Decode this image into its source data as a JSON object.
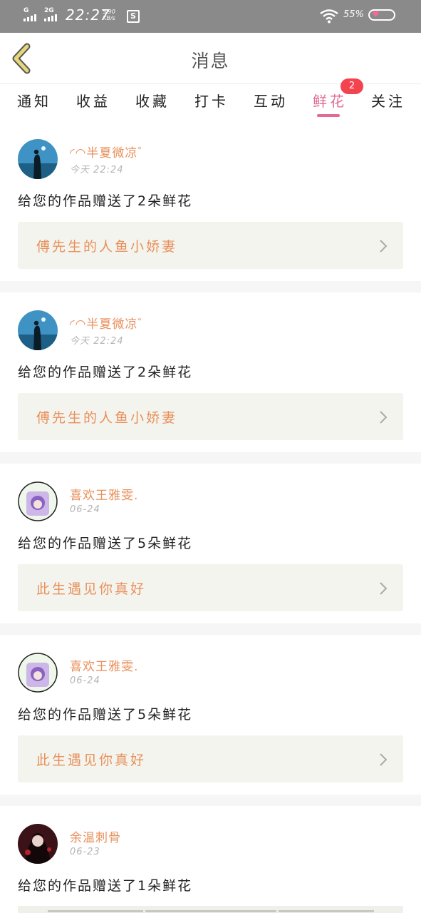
{
  "status_bar": {
    "sim1": "G",
    "sim2": "2G",
    "time": "22:27",
    "speed": "5.90",
    "speed_unit": "KB/s",
    "s_icon": "S",
    "battery": "55%"
  },
  "header": {
    "title": "消息"
  },
  "tabs": [
    {
      "label": "通知"
    },
    {
      "label": "收益"
    },
    {
      "label": "收藏"
    },
    {
      "label": "打卡"
    },
    {
      "label": "互动"
    },
    {
      "label": "鲜花",
      "active": true,
      "badge": "2"
    },
    {
      "label": "关注"
    }
  ],
  "messages": [
    {
      "user": "◜◠半夏微凉゛",
      "time": "今天 22:24",
      "text": "给您的作品赠送了2朵鲜花",
      "work": "傅先生的人鱼小娇妻",
      "avatar": "silhouette-sea"
    },
    {
      "user": "◜◠半夏微凉゛",
      "time": "今天 22:24",
      "text": "给您的作品赠送了2朵鲜花",
      "work": "傅先生的人鱼小娇妻",
      "avatar": "silhouette-sea"
    },
    {
      "user": "喜欢王雅雯.",
      "time": "06-24",
      "text": "给您的作品赠送了5朵鲜花",
      "work": "此生遇见你真好",
      "avatar": "anime-purple"
    },
    {
      "user": "喜欢王雅雯.",
      "time": "06-24",
      "text": "给您的作品赠送了5朵鲜花",
      "work": "此生遇见你真好",
      "avatar": "anime-purple"
    },
    {
      "user": "余温刺骨",
      "time": "06-23",
      "text": "给您的作品赠送了1朵鲜花",
      "work": "",
      "avatar": "dark-red"
    }
  ],
  "colors": {
    "accent": "#e26a96",
    "username": "#e8905c",
    "badge": "#f2434f",
    "card_bg": "#f4f4ee"
  }
}
